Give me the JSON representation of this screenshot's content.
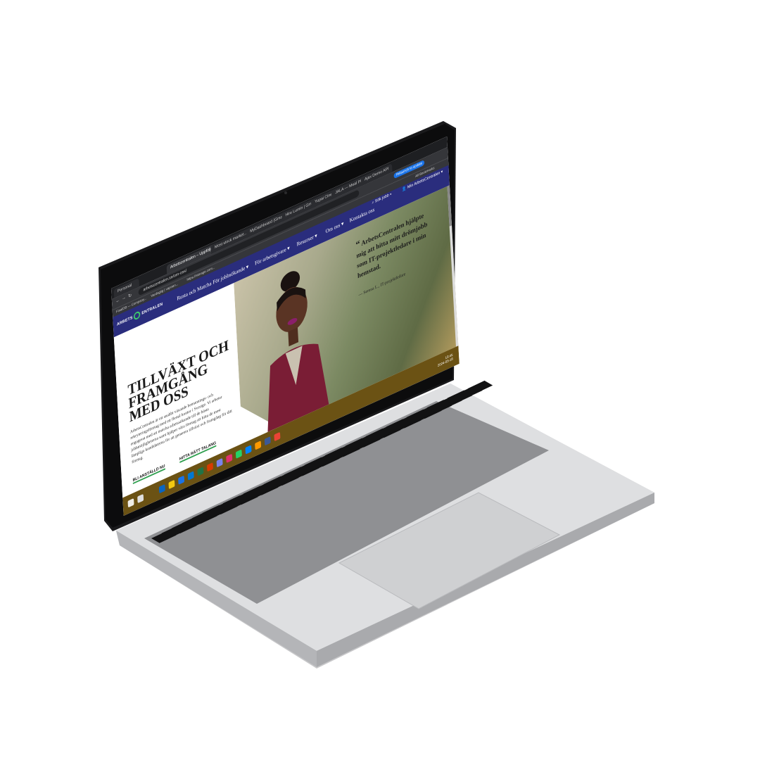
{
  "browser": {
    "profile_label": "Personal",
    "url": "arbetscentralen.se/om-oss/",
    "tabs": [
      "Arbetscentralen – Uppföljning",
      "Most stock market...",
      "MyDashboard (Gmail) Fi...",
      "Hire Lumin | Gmail",
      "Yupai Cinema",
      "JALA — Meal Planner",
      "Ajax Demo API"
    ],
    "bookmarks": [
      "FinalDB — Company...",
      "Vardaglig | vapnen...",
      "https://storage.com..."
    ],
    "cta_button": "Relaunch to update",
    "all_bookmarks": "All Bookmarks"
  },
  "nav": {
    "logo_left": "ARBETS",
    "logo_right": "ENTRALEN",
    "links": [
      "Rusta och Matcha",
      "För jobbsökande ▾",
      "För arbetsgivare ▾",
      "Resurser ▾",
      "Om oss ▾",
      "Kontakta oss"
    ],
    "search": "Sök jobb ▾",
    "account": "Min ArbetsCentralen ▾"
  },
  "hero": {
    "title": "TILLVÄXT OCH FRAMGÅNG MED OSS",
    "body": "ArbetsCentralen är ett snabbt växande bemannings- och rekryteringsföretag med ett flertal kontor i Sverige. Vi arbetar engagerat med att matcha arbetssökande till de bästa jobbmöjligheterna samt hjälper våra företag att hitta de mest lämpliga kandidaterna för att generera tillväxt och framgång för ditt företag.",
    "cta_primary": "BLI ANSTÄLLD NU",
    "cta_secondary": "HITTA RÄTT TALANG"
  },
  "quote": {
    "mark": "“",
    "text": "ArbetsCentralen hjälpte mig att hitta mitt drömjobb som IT-projektledare i min hemstad.",
    "author": "— Serena L., IT-projektledare"
  },
  "taskbar": {
    "time": "13:45",
    "date": "2024-03-18"
  },
  "colors": {
    "nav_bg": "#2a2d7d",
    "accent_green": "#2f9f4f",
    "taskbar_bg": "#6b5214"
  }
}
